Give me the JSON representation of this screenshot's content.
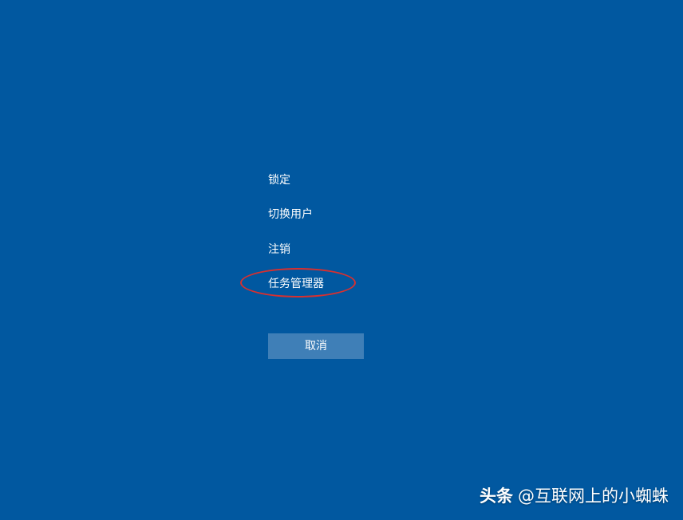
{
  "menu": {
    "items": [
      {
        "label": "锁定"
      },
      {
        "label": "切换用户"
      },
      {
        "label": "注销"
      },
      {
        "label": "任务管理器"
      }
    ]
  },
  "cancel_button": {
    "label": "取消"
  },
  "watermark": {
    "brand": "头条",
    "author": "@互联网上的小蜘蛛"
  },
  "colors": {
    "background": "#0158a0",
    "button": "#3f7fb7",
    "highlight": "#d8302f",
    "text": "#ffffff"
  }
}
